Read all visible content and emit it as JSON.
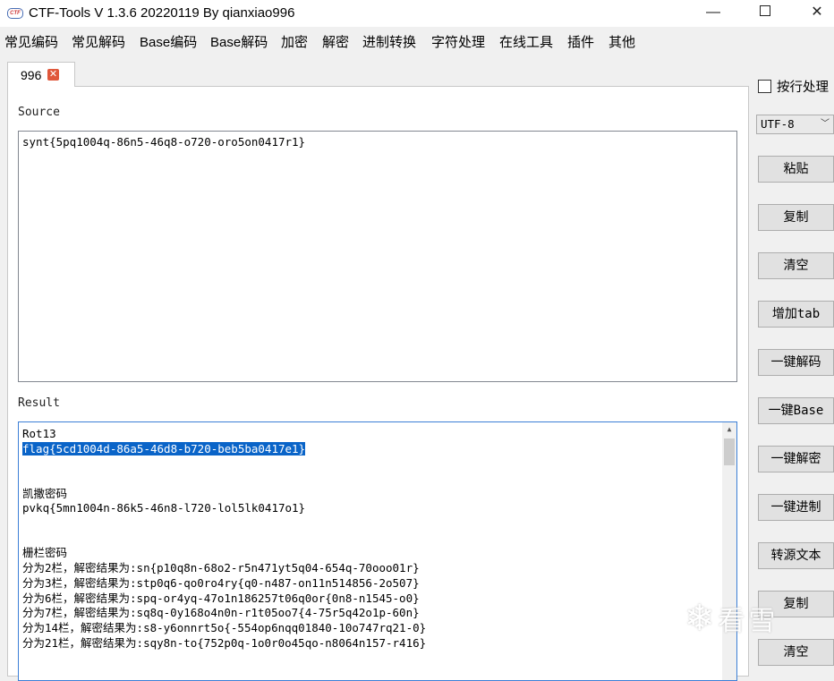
{
  "window": {
    "title": "CTF-Tools V 1.3.6 20220119 By qianxiao996",
    "icon_text": "CTF",
    "minimize": "—",
    "close": "✕"
  },
  "menu": [
    "常见编码",
    "常见解码",
    "Base编码",
    "Base解码",
    "加密",
    "解密",
    "进制转换",
    "字符处理",
    "在线工具",
    "插件",
    "其他"
  ],
  "tab": {
    "label": "996",
    "close": "✕"
  },
  "source": {
    "label": "Source",
    "value": "synt{5pq1004q-86n5-46q8-o720-oro5on0417r1}"
  },
  "result": {
    "label": "Result",
    "blocks": [
      {
        "lines": [
          "Rot13",
          "flag{5cd1004d-86a5-46d8-b720-beb5ba0417e1}"
        ]
      },
      {
        "lines": [
          "凯撒密码",
          "pvkq{5mn1004n-86k5-46n8-l720-lol5lk0417o1}"
        ]
      },
      {
        "lines": [
          "栅栏密码",
          "分为2栏，解密结果为:sn{p10q8n-68o2-r5n471yt5q04-654q-70ooo01r}",
          "分为3栏，解密结果为:stp0q6-qo0ro4ry{q0-n487-on11n514856-2o507}",
          "分为6栏，解密结果为:spq-or4yq-47o1n186257t06q0or{0n8-n1545-o0}",
          "分为7栏，解密结果为:sq8q-0y168o4n0n-r1t05oo7{4-75r5q42o1p-60n}",
          "分为14栏，解密结果为:s8-y6onnrt5o{-554op6nqq01840-10o747rq21-0}",
          "分为21栏，解密结果为:sqy8n-to{752p0q-1o0r0o45qo-n8064n157-r416}"
        ]
      }
    ]
  },
  "options": {
    "line_by_line_label": "按行处理",
    "line_by_line_checked": false,
    "encoding": "UTF-8"
  },
  "buttons": [
    "粘贴",
    "复制",
    "清空",
    "增加tab",
    "一键解码",
    "一键Base",
    "一键解密",
    "一键进制",
    "转源文本",
    "复制",
    "清空"
  ],
  "watermark": {
    "text": "看雪"
  },
  "colors": {
    "selection": "#0a64c8",
    "focus_border": "#3c7fd6",
    "tab_close": "#e0573b"
  }
}
